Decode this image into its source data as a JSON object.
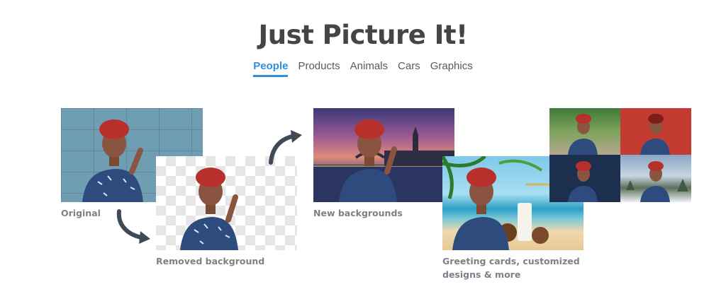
{
  "header": {
    "title": "Just Picture It!"
  },
  "tabs": [
    {
      "label": "People",
      "active": true
    },
    {
      "label": "Products",
      "active": false
    },
    {
      "label": "Animals",
      "active": false
    },
    {
      "label": "Cars",
      "active": false
    },
    {
      "label": "Graphics",
      "active": false
    }
  ],
  "showcase": {
    "original_caption": "Original",
    "removed_caption": "Removed background",
    "new_bg_caption": "New backgrounds",
    "greeting_caption_line1": "Greeting cards, customized",
    "greeting_caption_line2": "designs & more"
  },
  "colors": {
    "accent": "#2f8fe0",
    "title": "#454545",
    "caption": "#7c8089",
    "arrow": "#3e4a57"
  }
}
